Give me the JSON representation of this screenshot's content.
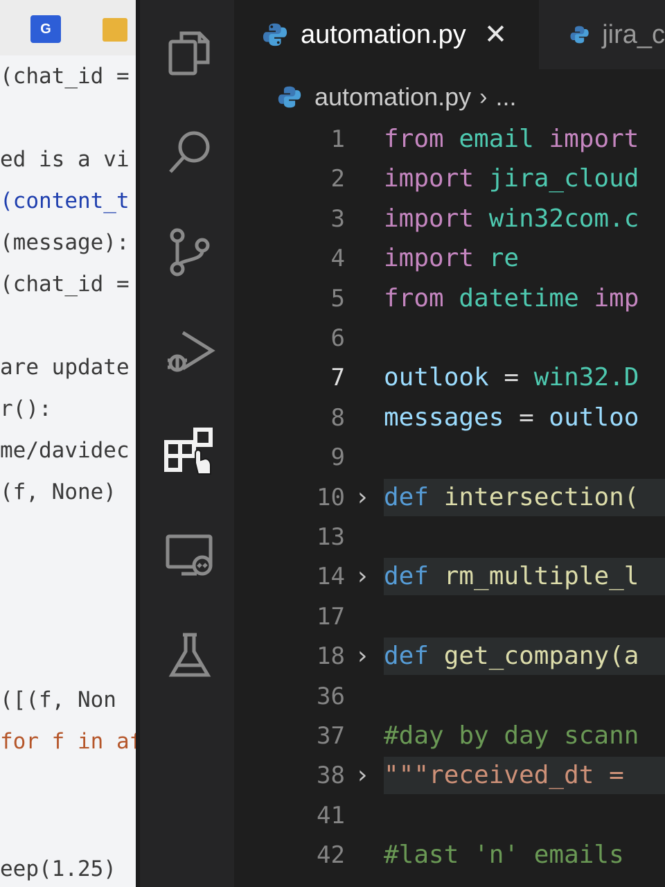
{
  "left_window": {
    "code_lines": [
      {
        "text": "(chat_id =",
        "color": "#3a3a3a"
      },
      {
        "text": "ed is a vi",
        "color": "#3a3a3a"
      },
      {
        "text": "(content_t",
        "color": "#1f3fae"
      },
      {
        "text": "(message):",
        "color": "#3a3a3a"
      },
      {
        "text": "(chat_id =",
        "color": "#3a3a3a"
      },
      {
        "text": "are update",
        "color": "#3a3a3a"
      },
      {
        "text": "r():",
        "color": "#3a3a3a"
      },
      {
        "text": "me/davidec",
        "color": "#3a3a3a"
      },
      {
        "text": "(f, None)",
        "color": "#3a3a3a"
      },
      {
        "text": "([(f, Non",
        "color": "#3a3a3a"
      },
      {
        "text": "for f in af",
        "color": "#b5562a"
      },
      {
        "text": "eep(1.25)",
        "color": "#3a3a3a"
      }
    ]
  },
  "activity_bar": {
    "items": [
      {
        "name": "explorer-icon"
      },
      {
        "name": "search-icon"
      },
      {
        "name": "source-control-icon"
      },
      {
        "name": "run-debug-icon"
      },
      {
        "name": "extensions-icon"
      },
      {
        "name": "remote-explorer-icon"
      },
      {
        "name": "testing-icon"
      }
    ]
  },
  "tabs": {
    "active": {
      "label": "automation.py",
      "close": "✕"
    },
    "inactive": {
      "label": "jira_c"
    }
  },
  "breadcrumb": {
    "file": "automation.py",
    "separator": "›",
    "more": "..."
  },
  "editor": {
    "lines": [
      {
        "number": "1",
        "tokens": [
          [
            "from ",
            "kw"
          ],
          [
            "email ",
            "mod"
          ],
          [
            "import",
            "kw"
          ]
        ]
      },
      {
        "number": "2",
        "tokens": [
          [
            "import ",
            "kw"
          ],
          [
            "jira_cloud",
            "mod"
          ]
        ]
      },
      {
        "number": "3",
        "tokens": [
          [
            "import ",
            "kw"
          ],
          [
            "win32com.c",
            "mod"
          ]
        ]
      },
      {
        "number": "4",
        "tokens": [
          [
            "import ",
            "kw"
          ],
          [
            "re",
            "mod"
          ]
        ]
      },
      {
        "number": "5",
        "tokens": [
          [
            "from ",
            "kw"
          ],
          [
            "datetime ",
            "mod"
          ],
          [
            "imp",
            "kw"
          ]
        ]
      },
      {
        "number": "6",
        "tokens": []
      },
      {
        "number": "7",
        "tokens": [
          [
            "outlook",
            "var"
          ],
          [
            " = ",
            "op"
          ],
          [
            "win32.D",
            "mod"
          ]
        ],
        "current": true
      },
      {
        "number": "8",
        "tokens": [
          [
            "messages",
            "var"
          ],
          [
            " = ",
            "op"
          ],
          [
            "outloo",
            "var"
          ]
        ]
      },
      {
        "number": "9",
        "tokens": []
      },
      {
        "number": "10",
        "tokens": [
          [
            "def ",
            "def"
          ],
          [
            "intersection(",
            "fn"
          ]
        ],
        "folded": true
      },
      {
        "number": "13",
        "tokens": []
      },
      {
        "number": "14",
        "tokens": [
          [
            "def ",
            "def"
          ],
          [
            "rm_multiple_l",
            "fn"
          ]
        ],
        "folded": true
      },
      {
        "number": "17",
        "tokens": []
      },
      {
        "number": "18",
        "tokens": [
          [
            "def ",
            "def"
          ],
          [
            "get_company(a",
            "fn"
          ]
        ],
        "folded": true
      },
      {
        "number": "36",
        "tokens": []
      },
      {
        "number": "37",
        "tokens": [
          [
            "#day by day scann",
            "cm"
          ]
        ]
      },
      {
        "number": "38",
        "tokens": [
          [
            "\"\"\"received_dt =",
            "str"
          ]
        ],
        "folded": true
      },
      {
        "number": "41",
        "tokens": []
      },
      {
        "number": "42",
        "tokens": [
          [
            "#last 'n' emails",
            "cm"
          ]
        ]
      }
    ]
  },
  "colors": {
    "editor_bg": "#1e1e1e",
    "activity_bar_bg": "#252526",
    "keyword": "#c586c0",
    "module": "#4ec9b0",
    "variable": "#9cdcfe",
    "def_keyword": "#569cd6",
    "function": "#dcdcaa",
    "comment": "#6a9955",
    "string": "#ce9178"
  }
}
